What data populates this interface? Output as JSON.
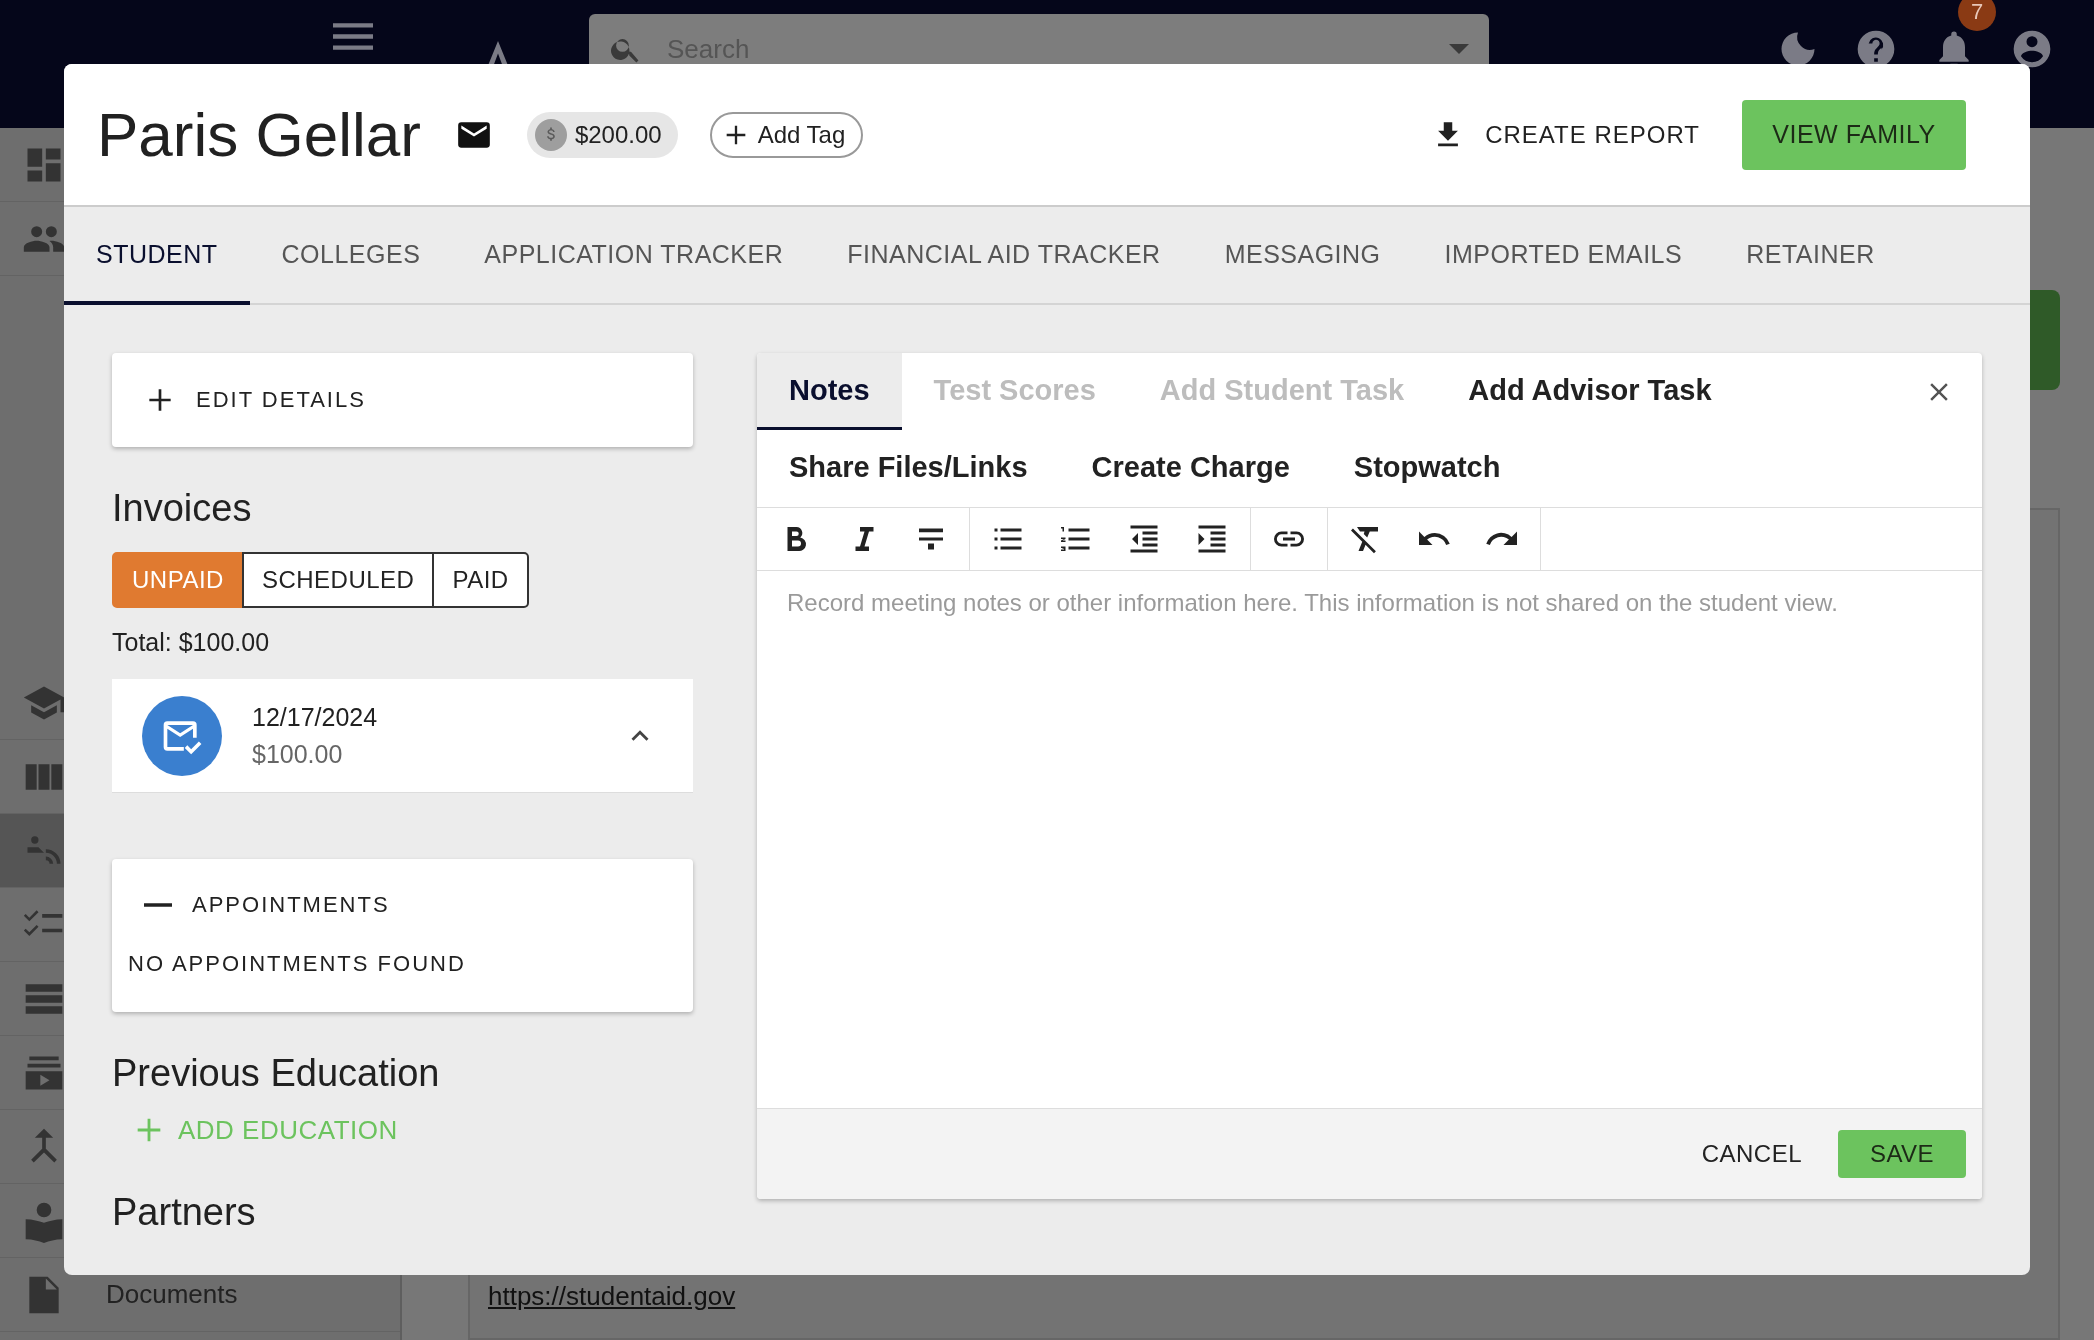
{
  "background": {
    "search": {
      "placeholder": "Search"
    },
    "notification_count": "7",
    "sidebar": {
      "items": [
        {
          "selected": false
        },
        {
          "selected": false
        },
        {
          "selected": false
        },
        {
          "selected": false
        },
        {
          "selected": true
        },
        {
          "selected": false
        },
        {
          "selected": false
        },
        {
          "selected": false
        },
        {
          "selected": false
        },
        {
          "selected": false
        },
        {
          "label": "Documents",
          "selected": false
        }
      ]
    },
    "link": "https://studentaid.gov"
  },
  "modal": {
    "title": "Paris Gellar",
    "balance": "$200.00",
    "add_tag": "Add Tag",
    "create_report": "CREATE REPORT",
    "view_family": "VIEW FAMILY",
    "tabs": [
      {
        "label": "STUDENT",
        "selected": true
      },
      {
        "label": "COLLEGES",
        "selected": false
      },
      {
        "label": "APPLICATION TRACKER",
        "selected": false
      },
      {
        "label": "FINANCIAL AID TRACKER",
        "selected": false
      },
      {
        "label": "MESSAGING",
        "selected": false
      },
      {
        "label": "IMPORTED EMAILS",
        "selected": false
      },
      {
        "label": "RETAINER",
        "selected": false
      }
    ],
    "edit_details": "EDIT DETAILS",
    "invoices": {
      "heading": "Invoices",
      "filters": [
        {
          "label": "UNPAID",
          "selected": true
        },
        {
          "label": "SCHEDULED",
          "selected": false
        },
        {
          "label": "PAID",
          "selected": false
        }
      ],
      "total": "Total: $100.00",
      "items": [
        {
          "date": "12/17/2024",
          "amount": "$100.00",
          "expanded": true
        }
      ]
    },
    "appointments": {
      "title": "APPOINTMENTS",
      "expanded": true,
      "empty": "NO APPOINTMENTS FOUND"
    },
    "previous_education": {
      "heading": "Previous Education",
      "action": "ADD EDUCATION"
    },
    "partners": {
      "heading": "Partners"
    },
    "notes_panel": {
      "tabs": [
        {
          "label": "Notes",
          "selected": true,
          "disabled": false
        },
        {
          "label": "Test Scores",
          "selected": false,
          "disabled": true
        },
        {
          "label": "Add Student Task",
          "selected": false,
          "disabled": true
        },
        {
          "label": "Add Advisor Task",
          "selected": false,
          "disabled": false
        },
        {
          "label": "Share Files/Links",
          "selected": false,
          "disabled": false
        },
        {
          "label": "Create Charge",
          "selected": false,
          "disabled": false
        },
        {
          "label": "Stopwatch",
          "selected": false,
          "disabled": false
        }
      ],
      "placeholder": "Record meeting notes or other information here. This information is not shared on the student view.",
      "cancel": "CANCEL",
      "save": "SAVE"
    }
  }
}
